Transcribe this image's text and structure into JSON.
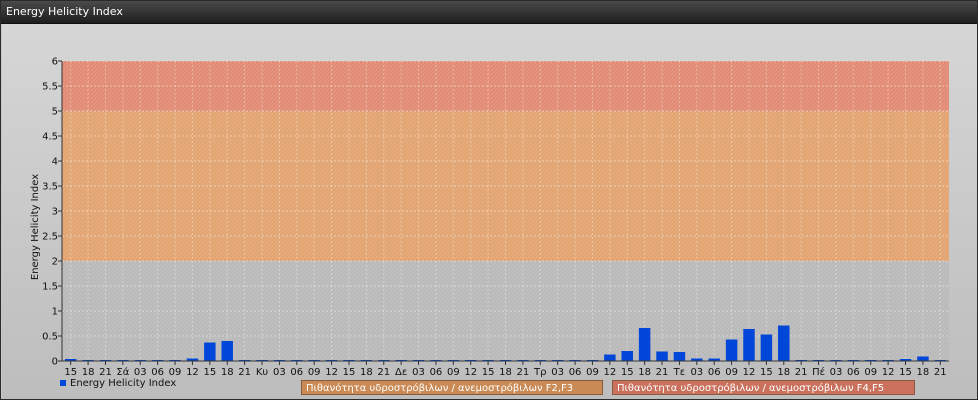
{
  "window": {
    "title": "Energy Helicity Index"
  },
  "chart_data": {
    "type": "bar",
    "title": "",
    "ylabel": "Energy Helicity Index",
    "xlabel": "",
    "ylim": [
      0,
      6
    ],
    "yticks": [
      "0",
      "0.5",
      "1",
      "1.5",
      "2",
      "2.5",
      "3",
      "3.5",
      "4",
      "4.5",
      "5",
      "5.5",
      "6"
    ],
    "grid": true,
    "legend_placement": "bottom-left",
    "bar_color": "#0047d9",
    "categories": [
      "15",
      "18",
      "21",
      "Σά",
      "03",
      "06",
      "09",
      "12",
      "15",
      "18",
      "21",
      "Κυ",
      "03",
      "06",
      "09",
      "12",
      "15",
      "18",
      "21",
      "Δε",
      "03",
      "06",
      "09",
      "12",
      "15",
      "18",
      "21",
      "Τρ",
      "03",
      "06",
      "09",
      "12",
      "15",
      "18",
      "21",
      "Τε",
      "03",
      "06",
      "09",
      "12",
      "15",
      "18",
      "21",
      "Πέ",
      "03",
      "06",
      "09",
      "12",
      "15",
      "18",
      "21"
    ],
    "series": [
      {
        "name": "Energy Helicity Index",
        "values": [
          0.04,
          0.02,
          0.02,
          0.02,
          0.02,
          0.02,
          0.02,
          0.05,
          0.37,
          0.4,
          0.02,
          0.02,
          0.02,
          0.02,
          0.02,
          0.02,
          0.02,
          0.02,
          0.02,
          0.02,
          0.02,
          0.02,
          0.02,
          0.02,
          0.02,
          0.02,
          0.02,
          0.02,
          0.02,
          0.02,
          0.02,
          0.13,
          0.2,
          0.66,
          0.19,
          0.18,
          0.05,
          0.05,
          0.43,
          0.64,
          0.53,
          0.71,
          0.02,
          0.02,
          0.02,
          0.02,
          0.02,
          0.02,
          0.04,
          0.09,
          0.02
        ]
      }
    ],
    "bands": [
      {
        "from": 0,
        "to": 2,
        "color": "#b9b9b9"
      },
      {
        "from": 2,
        "to": 5,
        "color": "#e2a470",
        "label": "Πιθανότητα υδροστρόβιλων / ανεμοστρόβιλων F2,F3"
      },
      {
        "from": 5,
        "to": 6,
        "color": "#e18a74",
        "label": "Πιθανότητα υδροστρόβιλων / ανεμοστρόβιλων F4,F5"
      }
    ]
  }
}
